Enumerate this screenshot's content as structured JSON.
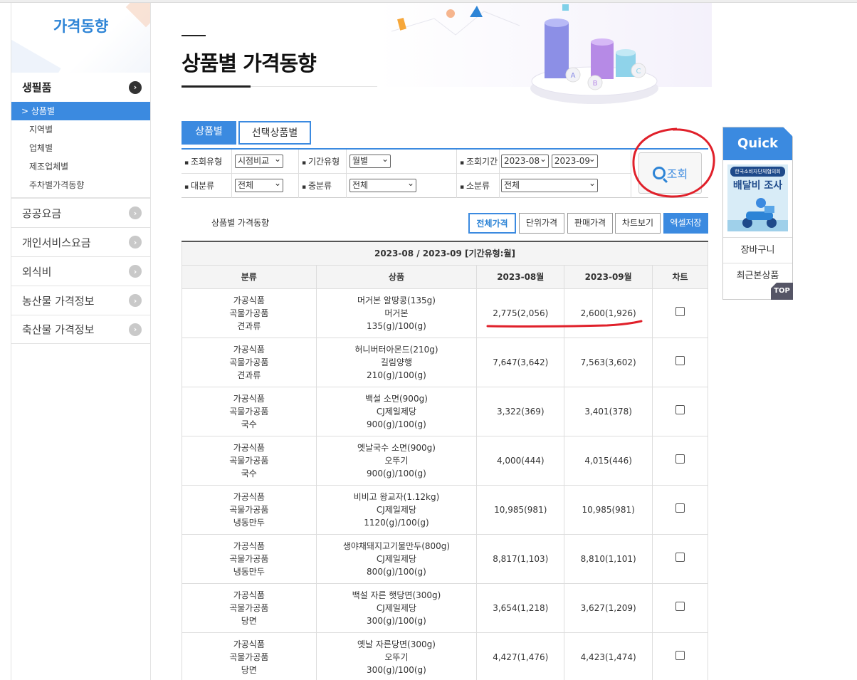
{
  "sidebar": {
    "title": "가격동향",
    "active_menu": "생필품",
    "sub_items": [
      "> 상품별",
      "지역별",
      "업체별",
      "제조업체별",
      "주차별가격동향"
    ],
    "menus": [
      "공공요금",
      "개인서비스요금",
      "외식비",
      "농산물 가격정보",
      "축산물 가격정보"
    ]
  },
  "header": {
    "title": "상품별 가격동향"
  },
  "hero_labels": {
    "a": "A",
    "b": "B",
    "c": "C"
  },
  "tabs": [
    "상품별",
    "선택상품별"
  ],
  "search": {
    "label_query_type": "조회유형",
    "query_type": "시점비교",
    "label_period_type": "기간유형",
    "period_type": "월별",
    "label_period": "조회기간",
    "period_from": "2023-08",
    "period_to": "2023-09",
    "label_major": "대분류",
    "major": "전체",
    "label_middle": "중분류",
    "middle": "전체",
    "label_minor": "소분류",
    "minor": "전체",
    "button": "조회"
  },
  "table_toolbar": {
    "caption": "상품별 가격동향",
    "buttons": [
      "전체가격",
      "단위가격",
      "판매가격",
      "차트보기",
      "엑셀저장"
    ]
  },
  "table": {
    "caption": "2023-08 / 2023-09 [기간유형:월]",
    "headers": [
      "분류",
      "상품",
      "2023-08월",
      "2023-09월",
      "차트"
    ],
    "rows": [
      {
        "cat1": "가공식품",
        "cat2": "곡물가공품",
        "cat3": "견과류",
        "name": "머거본 알땅콩(135g)",
        "maker": "머거본",
        "unit": "135(g)/100(g)",
        "p1": "2,775(2,056)",
        "p2": "2,600(1,926)"
      },
      {
        "cat1": "가공식품",
        "cat2": "곡물가공품",
        "cat3": "견과류",
        "name": "허니버터아몬드(210g)",
        "maker": "길림양행",
        "unit": "210(g)/100(g)",
        "p1": "7,647(3,642)",
        "p2": "7,563(3,602)"
      },
      {
        "cat1": "가공식품",
        "cat2": "곡물가공품",
        "cat3": "국수",
        "name": "백설 소면(900g)",
        "maker": "CJ제일제당",
        "unit": "900(g)/100(g)",
        "p1": "3,322(369)",
        "p2": "3,401(378)"
      },
      {
        "cat1": "가공식품",
        "cat2": "곡물가공품",
        "cat3": "국수",
        "name": "옛날국수 소면(900g)",
        "maker": "오뚜기",
        "unit": "900(g)/100(g)",
        "p1": "4,000(444)",
        "p2": "4,015(446)"
      },
      {
        "cat1": "가공식품",
        "cat2": "곡물가공품",
        "cat3": "냉동만두",
        "name": "비비고 왕교자(1.12kg)",
        "maker": "CJ제일제당",
        "unit": "1120(g)/100(g)",
        "p1": "10,985(981)",
        "p2": "10,985(981)"
      },
      {
        "cat1": "가공식품",
        "cat2": "곡물가공품",
        "cat3": "냉동만두",
        "name": "생야채돼지고기물만두(800g)",
        "maker": "CJ제일제당",
        "unit": "800(g)/100(g)",
        "p1": "8,817(1,103)",
        "p2": "8,810(1,101)"
      },
      {
        "cat1": "가공식품",
        "cat2": "곡물가공품",
        "cat3": "당면",
        "name": "백설 자른 햇당면(300g)",
        "maker": "CJ제일제당",
        "unit": "300(g)/100(g)",
        "p1": "3,654(1,218)",
        "p2": "3,627(1,209)"
      },
      {
        "cat1": "가공식품",
        "cat2": "곡물가공품",
        "cat3": "당면",
        "name": "옛날 자른당면(300g)",
        "maker": "오뚜기",
        "unit": "300(g)/100(g)",
        "p1": "4,427(1,476)",
        "p2": "4,423(1,474)"
      }
    ]
  },
  "quick": {
    "title": "Quick",
    "banner_small": "한국소비자단체협의회",
    "banner_big": "배달비 조사",
    "items": [
      "장바구니",
      "최근본상품"
    ],
    "top": "TOP"
  },
  "colors": {
    "accent": "#3b8ae0",
    "annotation": "#e0202a"
  }
}
